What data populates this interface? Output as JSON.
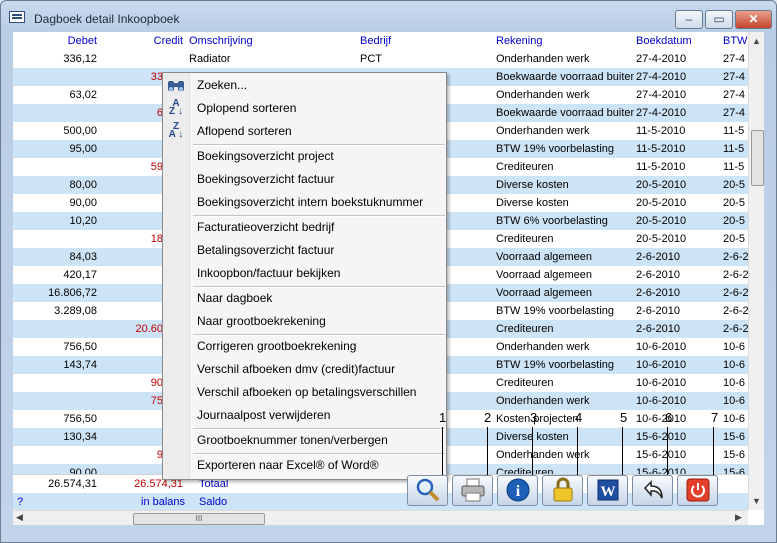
{
  "window": {
    "title": "Dagboek detail Inkoopboek"
  },
  "columns": [
    "Debet",
    "Credit",
    "Omschrijving",
    "Bedrijf",
    "Rekening",
    "Boekdatum",
    "BTW"
  ],
  "rows": [
    {
      "debet": "336,12",
      "credit": "",
      "omschrijving": "Radiator",
      "bedrijf": "PCT",
      "rekening": "Onderhanden werk",
      "datum": "27-4-2010",
      "btw": "27-4"
    },
    {
      "debet": "",
      "credit": "33",
      "omschrijving": "",
      "bedrijf": "",
      "rekening": "Boekwaarde voorraad buiten",
      "datum": "27-4-2010",
      "btw": "27-4"
    },
    {
      "debet": "63,02",
      "credit": "",
      "omschrijving": "",
      "bedrijf": "",
      "rekening": "Onderhanden werk",
      "datum": "27-4-2010",
      "btw": "27-4"
    },
    {
      "debet": "",
      "credit": "6",
      "omschrijving": "",
      "bedrijf": "",
      "rekening": "Boekwaarde voorraad buiten",
      "datum": "27-4-2010",
      "btw": "27-4"
    },
    {
      "debet": "500,00",
      "credit": "",
      "omschrijving": "",
      "bedrijf": "",
      "rekening": "Onderhanden werk",
      "datum": "11-5-2010",
      "btw": "11-5"
    },
    {
      "debet": "95,00",
      "credit": "",
      "omschrijving": "",
      "bedrijf": "",
      "rekening": "BTW 19% voorbelasting",
      "datum": "11-5-2010",
      "btw": "11-5"
    },
    {
      "debet": "",
      "credit": "59",
      "omschrijving": "",
      "bedrijf": "",
      "rekening": "Crediteuren",
      "datum": "11-5-2010",
      "btw": "11-5"
    },
    {
      "debet": "80,00",
      "credit": "",
      "omschrijving": "",
      "bedrijf": "",
      "rekening": "Diverse kosten",
      "datum": "20-5-2010",
      "btw": "20-5"
    },
    {
      "debet": "90,00",
      "credit": "",
      "omschrijving": "",
      "bedrijf": "",
      "rekening": "Diverse kosten",
      "datum": "20-5-2010",
      "btw": "20-5"
    },
    {
      "debet": "10,20",
      "credit": "",
      "omschrijving": "",
      "bedrijf": "",
      "rekening": "BTW 6% voorbelasting",
      "datum": "20-5-2010",
      "btw": "20-5"
    },
    {
      "debet": "",
      "credit": "18",
      "omschrijving": "",
      "bedrijf": "",
      "rekening": "Crediteuren",
      "datum": "20-5-2010",
      "btw": "20-5"
    },
    {
      "debet": "84,03",
      "credit": "",
      "omschrijving": "",
      "bedrijf": "",
      "rekening": "Voorraad algemeen",
      "datum": "2-6-2010",
      "btw": "2-6-2"
    },
    {
      "debet": "420,17",
      "credit": "",
      "omschrijving": "",
      "bedrijf": "",
      "rekening": "Voorraad algemeen",
      "datum": "2-6-2010",
      "btw": "2-6-2"
    },
    {
      "debet": "16.806,72",
      "credit": "",
      "omschrijving": "",
      "bedrijf": "",
      "rekening": "Voorraad algemeen",
      "datum": "2-6-2010",
      "btw": "2-6-2"
    },
    {
      "debet": "3.289,08",
      "credit": "",
      "omschrijving": "",
      "bedrijf": "",
      "rekening": "BTW 19% voorbelasting",
      "datum": "2-6-2010",
      "btw": "2-6-2"
    },
    {
      "debet": "",
      "credit": "20.60",
      "omschrijving": "",
      "bedrijf": "",
      "rekening": "Crediteuren",
      "datum": "2-6-2010",
      "btw": "2-6-2"
    },
    {
      "debet": "756,50",
      "credit": "",
      "omschrijving": "",
      "bedrijf": "",
      "rekening": "Onderhanden werk",
      "datum": "10-6-2010",
      "btw": "10-6"
    },
    {
      "debet": "143,74",
      "credit": "",
      "omschrijving": "",
      "bedrijf": "",
      "rekening": "BTW 19% voorbelasting",
      "datum": "10-6-2010",
      "btw": "10-6"
    },
    {
      "debet": "",
      "credit": "90",
      "omschrijving": "",
      "bedrijf": "",
      "rekening": "Crediteuren",
      "datum": "10-6-2010",
      "btw": "10-6"
    },
    {
      "debet": "",
      "credit": "75",
      "omschrijving": "",
      "bedrijf": "",
      "rekening": "Onderhanden werk",
      "datum": "10-6-2010",
      "btw": "10-6"
    },
    {
      "debet": "756,50",
      "credit": "",
      "omschrijving": "",
      "bedrijf": "",
      "rekening": "Kosten projecten",
      "datum": "10-6-2010",
      "btw": "10-6"
    },
    {
      "debet": "130,34",
      "credit": "",
      "omschrijving": "",
      "bedrijf": "",
      "rekening": "Diverse kosten",
      "datum": "15-6-2010",
      "btw": "15-6"
    },
    {
      "debet": "",
      "credit": "9",
      "omschrijving": "",
      "bedrijf": "",
      "rekening": "Onderhanden werk",
      "datum": "15-6-2010",
      "btw": "15-6"
    },
    {
      "debet": "90,00",
      "credit": "",
      "omschrijving": "",
      "bedrijf": "",
      "rekening": "Crediteuren",
      "datum": "15-6-2010",
      "btw": "15-6"
    }
  ],
  "totals": {
    "debet": "26.574,31",
    "credit": "26.574,31",
    "label": "Totaal"
  },
  "saldo": {
    "marker": "?",
    "status": "in balans",
    "label": "Saldo"
  },
  "menu": {
    "items": [
      {
        "label": "Zoeken...",
        "icon": "binoculars-icon"
      },
      {
        "label": "Oplopend sorteren",
        "icon": "sort-ascending-icon"
      },
      {
        "label": "Aflopend sorteren",
        "icon": "sort-descending-icon"
      },
      {
        "label": "Boekingsoverzicht project"
      },
      {
        "label": "Boekingsoverzicht factuur"
      },
      {
        "label": "Boekingsoverzicht intern boekstuknummer"
      },
      {
        "label": "Facturatieoverzicht bedrijf"
      },
      {
        "label": "Betalingsoverzicht factuur"
      },
      {
        "label": "Inkoopbon/factuur bekijken"
      },
      {
        "label": "Naar dagboek"
      },
      {
        "label": "Naar grootboekrekening"
      },
      {
        "label": "Corrigeren grootboekrekening"
      },
      {
        "label": "Verschil afboeken dmv (credit)factuur"
      },
      {
        "label": "Verschil afboeken op betalingsverschillen"
      },
      {
        "label": "Journaalpost verwijderen"
      },
      {
        "label": "Grootboeknummer tonen/verbergen"
      },
      {
        "label": "Exporteren naar Excel® of Word®"
      }
    ]
  },
  "toolbar": {
    "callouts": [
      "1",
      "2",
      "3",
      "4",
      "5",
      "6",
      "7"
    ],
    "buttons": [
      {
        "icon": "magnifier-icon"
      },
      {
        "icon": "printer-icon"
      },
      {
        "icon": "info-icon"
      },
      {
        "icon": "lock-icon"
      },
      {
        "icon": "word-icon"
      },
      {
        "icon": "undo-icon"
      },
      {
        "icon": "power-icon"
      }
    ]
  },
  "hscroll": {
    "grip": "III"
  }
}
